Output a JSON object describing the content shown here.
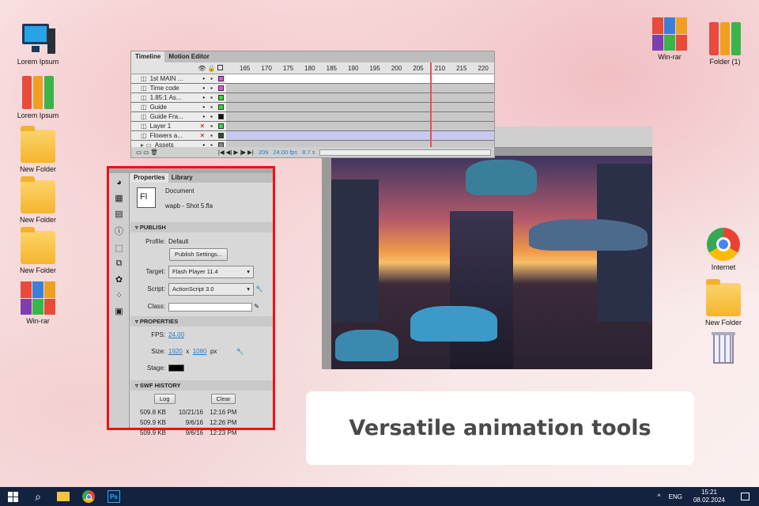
{
  "desktop": {
    "left_icons": [
      {
        "label": "Lorem Ipsum",
        "icon": "computer-icon"
      },
      {
        "label": "Lorem Ipsum",
        "icon": "binders-icon"
      },
      {
        "label": "New Folder",
        "icon": "folder-icon"
      },
      {
        "label": "New Folder",
        "icon": "folder-icon"
      },
      {
        "label": "New Folder",
        "icon": "folder-icon"
      },
      {
        "label": "Win-rar",
        "icon": "winrar-icon"
      }
    ],
    "right_icons": [
      {
        "label": "Win-rar",
        "icon": "winrar-icon"
      },
      {
        "label": "Folder (1)",
        "icon": "binders-icon"
      },
      {
        "label": "Internet",
        "icon": "chrome-icon"
      },
      {
        "label": "New Folder",
        "icon": "folder-icon"
      },
      {
        "label": "",
        "icon": "trash-icon"
      }
    ]
  },
  "timeline": {
    "tabs": [
      "Timeline",
      "Motion Editor"
    ],
    "ruler": [
      "165",
      "170",
      "175",
      "180",
      "185",
      "190",
      "195",
      "200",
      "205",
      "210",
      "215",
      "220"
    ],
    "layers": [
      {
        "name": "1st MAIN ...",
        "color": "#e84de8",
        "hidden": false
      },
      {
        "name": "Time code",
        "color": "#e84de8",
        "hidden": false
      },
      {
        "name": "1.85:1 As...",
        "color": "#33dd33",
        "hidden": false
      },
      {
        "name": "Guide",
        "color": "#33dd33",
        "hidden": false
      },
      {
        "name": "Guide Fra...",
        "color": "#111111",
        "hidden": false
      },
      {
        "name": "Layer 1",
        "color": "#33dd33",
        "hidden": true
      },
      {
        "name": "Flowers a...",
        "color": "#1f5a1f",
        "hidden": true
      },
      {
        "name": "Assets",
        "color": "#888888",
        "hidden": false
      }
    ],
    "frame": "209",
    "fps": "24.00 fps",
    "time": "8.7 s"
  },
  "properties": {
    "tabs": [
      "Properties",
      "Library"
    ],
    "doc_icon": "Fl",
    "doc_type": "Document",
    "doc_name": "wapb - Shot 5.fla",
    "publish": {
      "header": "PUBLISH",
      "profile_label": "Profile:",
      "profile": "Default",
      "settings_btn": "Publish Settings...",
      "target_label": "Target:",
      "target": "Flash Player 11.4",
      "script_label": "Script:",
      "script": "ActionScript 3.0",
      "class_label": "Class:",
      "class_value": ""
    },
    "props": {
      "header": "PROPERTIES",
      "fps_label": "FPS:",
      "fps": "24.00",
      "size_label": "Size:",
      "width": "1920",
      "x": "x",
      "height": "1080",
      "unit": "px",
      "stage_label": "Stage:",
      "stage_color": "#000000"
    },
    "history": {
      "header": "SWF HISTORY",
      "log": "Log",
      "clear": "Clear",
      "rows": [
        [
          "509.8 KB",
          "10/21/16",
          "12:16 PM"
        ],
        [
          "509.9 KB",
          "9/6/16",
          "12:26 PM"
        ],
        [
          "509.9 KB",
          "9/6/16",
          "12:23 PM"
        ]
      ]
    }
  },
  "caption": "Versatile animation tools",
  "taskbar": {
    "lang": "ENG",
    "time": "15:21",
    "date": "08.02.2024"
  }
}
